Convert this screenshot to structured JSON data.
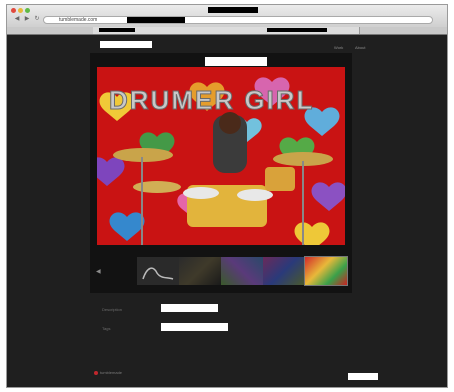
{
  "browser": {
    "url_text": "tumblemade.com",
    "tabs": [
      "",
      ""
    ]
  },
  "nav": {
    "items": [
      "Work",
      "About"
    ]
  },
  "slideshow": {
    "title_text": "DRUMER GIRL",
    "thumbnails": [
      "sketch",
      "drummer-dark",
      "colors-a",
      "colors-b",
      "drumer-girl",
      "colors-c"
    ],
    "active_thumbnail": 4
  },
  "form": {
    "labels": [
      "Description",
      "Tags"
    ]
  },
  "footer": {
    "logo_text": "tumblemade"
  },
  "colors": {
    "page_bg": "#1f1f1f",
    "stage_bg": "#121212",
    "accent_red": "#cc1414"
  }
}
